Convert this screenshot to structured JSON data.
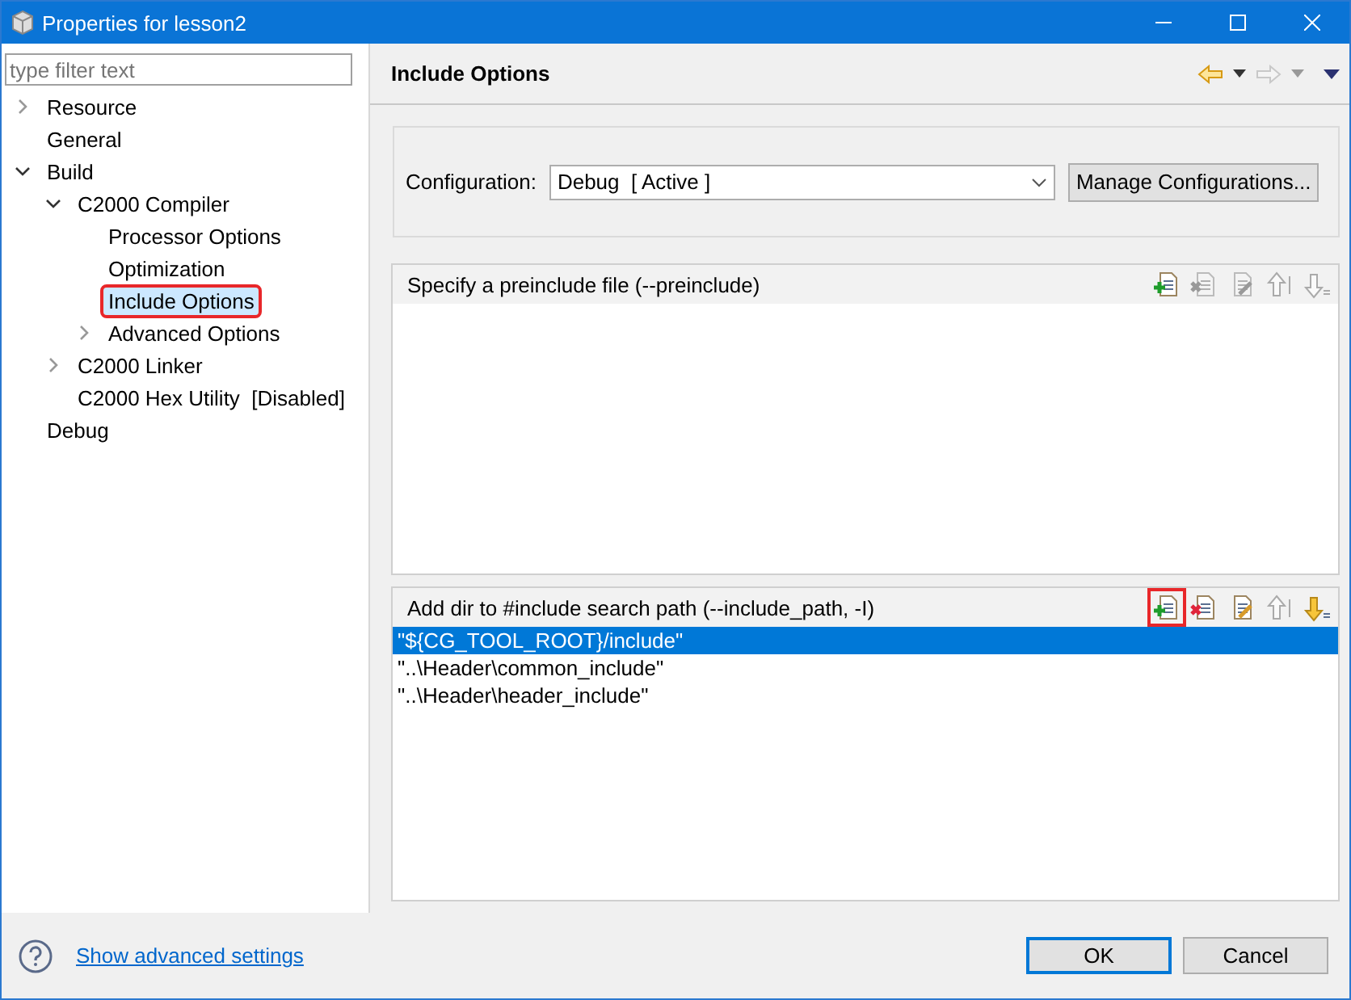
{
  "window": {
    "title": "Properties for lesson2"
  },
  "filter": {
    "placeholder": "type filter text"
  },
  "tree": [
    {
      "label": "Resource",
      "expanded": false,
      "selected": false
    },
    {
      "label": "General",
      "selected": false
    },
    {
      "label": "Build",
      "expanded": true,
      "selected": false,
      "children": [
        {
          "label": "C2000 Compiler",
          "expanded": true,
          "selected": false,
          "children": [
            {
              "label": "Processor Options",
              "selected": false
            },
            {
              "label": "Optimization",
              "selected": false
            },
            {
              "label": "Include Options",
              "selected": true,
              "annotated": true
            },
            {
              "label": "Advanced Options",
              "expanded": false,
              "selected": false
            }
          ]
        },
        {
          "label": "C2000 Linker",
          "expanded": false,
          "selected": false
        },
        {
          "label": "C2000 Hex Utility  [Disabled]",
          "selected": false
        }
      ]
    },
    {
      "label": "Debug",
      "selected": false
    }
  ],
  "page_title": "Include Options",
  "configuration": {
    "label": "Configuration:",
    "value": "Debug  [ Active ]",
    "button": "Manage Configurations..."
  },
  "lists": [
    {
      "title": "Specify a preinclude file (--preinclude)",
      "tools": [
        {
          "kind": "add",
          "disabled": false,
          "annotated": false
        },
        {
          "kind": "delete",
          "disabled": true
        },
        {
          "kind": "edit",
          "disabled": true
        },
        {
          "kind": "up",
          "disabled": true
        },
        {
          "kind": "down",
          "disabled": true
        }
      ]
    },
    {
      "title": "Add dir to #include search path (--include_path, -I)",
      "tools": [
        {
          "kind": "add",
          "disabled": false,
          "annotated": true
        },
        {
          "kind": "delete",
          "disabled": false
        },
        {
          "kind": "edit",
          "disabled": false
        },
        {
          "kind": "up",
          "disabled": true
        },
        {
          "kind": "down",
          "disabled": false
        }
      ],
      "items": [
        {
          "text": "\"${CG_TOOL_ROOT}/include\"",
          "selected": true
        },
        {
          "text": "\"..\\Header\\common_include\"",
          "selected": false
        },
        {
          "text": "\"..\\Header\\header_include\"",
          "selected": false
        }
      ]
    }
  ],
  "footer": {
    "link": "Show advanced settings",
    "buttons": [
      {
        "label": "OK",
        "default": true
      },
      {
        "label": "Cancel",
        "default": false
      }
    ]
  }
}
